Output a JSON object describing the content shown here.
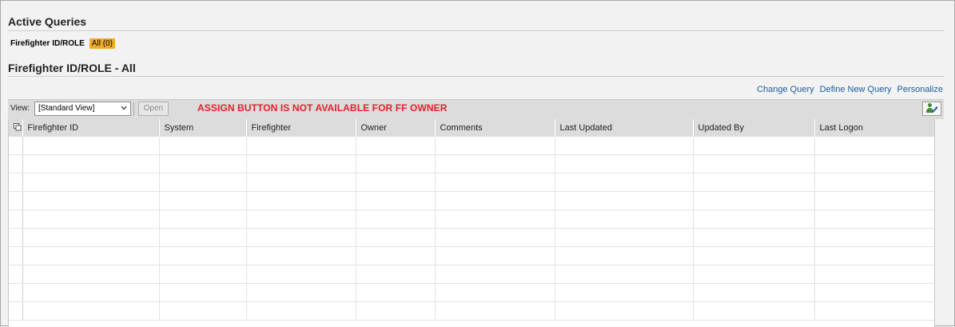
{
  "active_queries": {
    "title": "Active Queries",
    "query_label": "Firefighter ID/ROLE",
    "query_badge": "All (0)"
  },
  "result": {
    "title": "Firefighter ID/ROLE - All",
    "links": {
      "change_query": "Change Query",
      "define_new_query": "Define New Query",
      "personalize": "Personalize"
    },
    "toolbar": {
      "view_label": "View:",
      "view_value": "[Standard View]",
      "open_label": "Open",
      "alert": "ASSIGN BUTTON IS NOT AVAILABLE FOR FF OWNER",
      "alert_color": "#e3202a",
      "personalize_icon": "user-settings-icon"
    },
    "table": {
      "select_all_icon": "select-all-icon",
      "columns": [
        "Firefighter ID",
        "System",
        "Firefighter",
        "Owner",
        "Comments",
        "Last Updated",
        "Updated By",
        "Last Logon"
      ],
      "rows": [
        [
          "",
          "",
          "",
          "",
          "",
          "",
          "",
          ""
        ],
        [
          "",
          "",
          "",
          "",
          "",
          "",
          "",
          ""
        ],
        [
          "",
          "",
          "",
          "",
          "",
          "",
          "",
          ""
        ],
        [
          "",
          "",
          "",
          "",
          "",
          "",
          "",
          ""
        ],
        [
          "",
          "",
          "",
          "",
          "",
          "",
          "",
          ""
        ],
        [
          "",
          "",
          "",
          "",
          "",
          "",
          "",
          ""
        ],
        [
          "",
          "",
          "",
          "",
          "",
          "",
          "",
          ""
        ],
        [
          "",
          "",
          "",
          "",
          "",
          "",
          "",
          ""
        ],
        [
          "",
          "",
          "",
          "",
          "",
          "",
          "",
          ""
        ],
        [
          "",
          "",
          "",
          "",
          "",
          "",
          "",
          ""
        ]
      ]
    }
  },
  "colors": {
    "background": "#f2f2f2",
    "badge": "#f0ab2d",
    "link": "#1a5ea0"
  }
}
